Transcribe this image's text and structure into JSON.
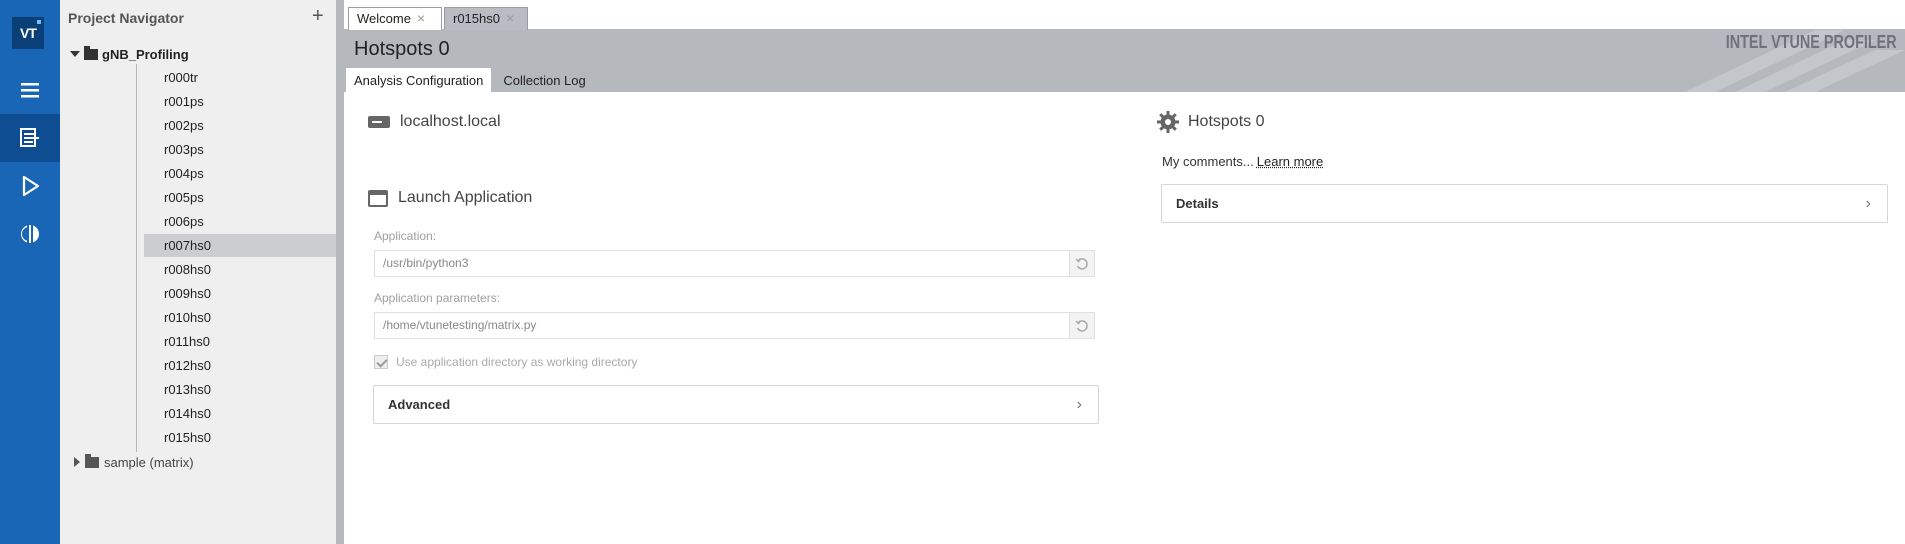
{
  "activity_bar": {
    "logo_text": "VT",
    "items": [
      {
        "name": "menu-icon",
        "active": false
      },
      {
        "name": "project-navigator-icon",
        "active": true
      },
      {
        "name": "run-icon",
        "active": false
      },
      {
        "name": "compare-icon",
        "active": false
      }
    ],
    "colors": {
      "bar": "#1a66b6",
      "active": "#0e4d91"
    }
  },
  "navigator": {
    "title": "Project Navigator",
    "add_label": "+",
    "root_project": "gNB_Profiling",
    "results": [
      "r000tr",
      "r001ps",
      "r002ps",
      "r003ps",
      "r004ps",
      "r005ps",
      "r006ps",
      "r007hs0",
      "r008hs0",
      "r009hs0",
      "r010hs0",
      "r011hs0",
      "r012hs0",
      "r013hs0",
      "r014hs0",
      "r015hs0"
    ],
    "selected_result": "r007hs0",
    "second_project": "sample (matrix)"
  },
  "doc_tabs": [
    {
      "label": "Welcome",
      "close": "×",
      "active": false
    },
    {
      "label": "r015hs0",
      "close": "×",
      "active": true
    }
  ],
  "header": {
    "title": "Hotspots 0",
    "brand": "INTEL VTUNE PROFILER",
    "tabs": [
      "Analysis Configuration",
      "Collection Log"
    ],
    "active_tab": "Analysis Configuration"
  },
  "target": {
    "host": "localhost.local",
    "launch_title": "Launch Application",
    "application_label": "Application:",
    "application_value": "/usr/bin/python3",
    "params_label": "Application parameters:",
    "params_value": "/home/vtunetesting/matrix.py",
    "working_dir_label": "Use application directory as working directory",
    "working_dir_checked": true,
    "advanced_label": "Advanced",
    "chevron": "›"
  },
  "analysis": {
    "title": "Hotspots 0",
    "comments": "My comments...",
    "learn_more": "Learn more",
    "details_label": "Details",
    "chevron": "›"
  }
}
